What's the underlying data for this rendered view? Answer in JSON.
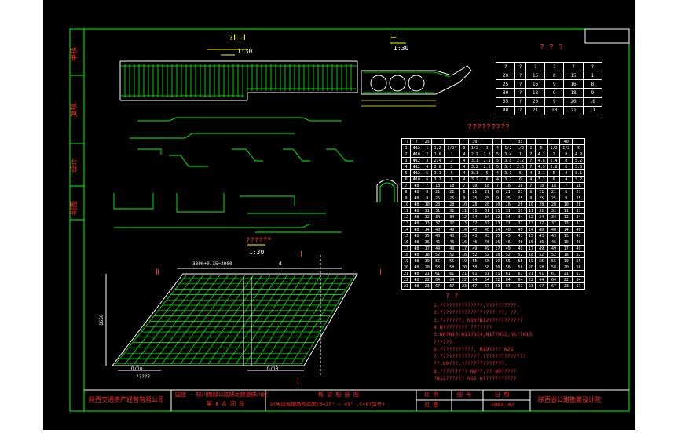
{
  "drawing": {
    "section_title_left": "?Ⅱ—Ⅱ",
    "section_scale_left": "1:30",
    "section_title_mid": "Ⅰ—Ⅰ",
    "section_scale_mid": "1:30",
    "plan_title": "??????",
    "plan_scale": "1:30",
    "small_table_title": "? ? ?",
    "big_table_title": "?????????",
    "plan_dim_top": "3300+0.35=2000",
    "plan_dim_d": "d",
    "plan_label_bl": "D/10",
    "plan_label_br": "D/10",
    "plan_note": "?????",
    "mark_I_top": "Ⅰ",
    "mark_I_bottom": "Ⅰ",
    "mark_II_left": "Ⅱ",
    "mark_I_right": "Ⅰ",
    "dim_1650": "1650"
  },
  "left_strip": {
    "labels": [
      "审核",
      "复核",
      "设计",
      "制图"
    ]
  },
  "small_table": {
    "rows": [
      [
        "?",
        "?",
        "?",
        "?",
        "?",
        "?"
      ],
      [
        "20",
        "?",
        "15",
        "8",
        "15",
        "1"
      ],
      [
        "25",
        "?",
        "16",
        "9",
        "16",
        "8"
      ],
      [
        "30",
        "?",
        "18",
        "9",
        "18",
        "9"
      ],
      [
        "35",
        "?",
        "20",
        "9",
        "20",
        "10"
      ],
      [
        "40",
        "?",
        "21",
        "10",
        "21",
        "11"
      ]
    ]
  },
  "big_table": {
    "header": [
      "??",
      "?",
      "25",
      "",
      "",
      "",
      "30",
      "",
      "",
      "",
      "35",
      "",
      "",
      "",
      "40",
      ""
    ],
    "rows": [
      [
        "1",
        "Φ12",
        "1",
        "1/2",
        "1/24",
        "3",
        "1/2",
        "1",
        "4",
        "1/2",
        "1/2",
        "1",
        "5",
        "1/2",
        "1/2",
        "5"
      ],
      [
        "2",
        "Φ10",
        "2",
        "1.6",
        "1",
        "4",
        "2.7",
        "1.8",
        "5",
        "3.4",
        "1",
        "7",
        "4.2",
        "2",
        "8",
        "4.9"
      ],
      [
        "3",
        "Φ12",
        "3",
        "2/4",
        "2",
        "4",
        "3.1",
        "2.1",
        "5",
        "3.8",
        "2.2",
        "7",
        "4.6",
        "2.4",
        "8",
        "5.2"
      ],
      [
        "4",
        "Φ12",
        "4",
        "2.8",
        "2",
        "4",
        "3.2",
        "2.8",
        "5",
        "3.9",
        "2.6",
        "7",
        "4.9",
        "2.8",
        "8",
        "5.6"
      ],
      [
        "5",
        "Φ12",
        "5",
        "3.1",
        "5",
        "4",
        "3.1",
        "5",
        "4",
        "3.1",
        "5",
        "4",
        "3.1",
        "5",
        "4",
        "3.1"
      ],
      [
        "6",
        "Φ10",
        "6",
        "3.2",
        "6",
        "4",
        "3.2",
        "6",
        "4",
        "3.2",
        "6",
        "4",
        "3.2",
        "6",
        "4",
        "3.2"
      ],
      [
        "7",
        "Φ8",
        "7",
        "18",
        "18",
        "7",
        "18",
        "18",
        "7",
        "18",
        "18",
        "7",
        "18",
        "18",
        "7",
        "18"
      ],
      [
        "8",
        "Φ8",
        "8",
        "21",
        "21",
        "8",
        "21",
        "21",
        "8",
        "21",
        "21",
        "8",
        "21",
        "21",
        "8",
        "21"
      ],
      [
        "9",
        "Φ8",
        "9",
        "25",
        "25",
        "9",
        "25",
        "25",
        "9",
        "25",
        "25",
        "9",
        "25",
        "25",
        "9",
        "25"
      ],
      [
        "10",
        "Φ8",
        "10",
        "28",
        "28",
        "10",
        "28",
        "28",
        "10",
        "28",
        "28",
        "10",
        "28",
        "28",
        "10",
        "28"
      ],
      [
        "11",
        "Φ8",
        "11",
        "31",
        "31",
        "11",
        "31",
        "31",
        "11",
        "31",
        "31",
        "11",
        "31",
        "31",
        "11",
        "31"
      ],
      [
        "12",
        "Φ8",
        "12",
        "34",
        "34",
        "12",
        "34",
        "34",
        "12",
        "34",
        "34",
        "12",
        "34",
        "34",
        "12",
        "34"
      ],
      [
        "13",
        "Φ8",
        "13",
        "37",
        "37",
        "13",
        "37",
        "37",
        "13",
        "37",
        "37",
        "13",
        "37",
        "37",
        "13",
        "37"
      ],
      [
        "14",
        "Φ8",
        "14",
        "40",
        "40",
        "14",
        "40",
        "40",
        "14",
        "40",
        "40",
        "14",
        "40",
        "40",
        "14",
        "40"
      ],
      [
        "15",
        "Φ8",
        "15",
        "43",
        "43",
        "15",
        "43",
        "43",
        "15",
        "43",
        "43",
        "15",
        "43",
        "43",
        "15",
        "43"
      ],
      [
        "16",
        "Φ8",
        "16",
        "46",
        "46",
        "16",
        "46",
        "46",
        "16",
        "46",
        "46",
        "16",
        "46",
        "46",
        "16",
        "46"
      ],
      [
        "17",
        "Φ8",
        "17",
        "49",
        "49",
        "17",
        "49",
        "49",
        "17",
        "49",
        "49",
        "17",
        "49",
        "49",
        "17",
        "49"
      ],
      [
        "18",
        "Φ8",
        "18",
        "52",
        "52",
        "18",
        "52",
        "52",
        "18",
        "52",
        "52",
        "18",
        "52",
        "52",
        "18",
        "52"
      ],
      [
        "19",
        "Φ8",
        "19",
        "55",
        "55",
        "19",
        "55",
        "55",
        "19",
        "55",
        "55",
        "19",
        "55",
        "55",
        "19",
        "55"
      ],
      [
        "20",
        "Φ8",
        "20",
        "58",
        "58",
        "20",
        "58",
        "58",
        "20",
        "58",
        "58",
        "20",
        "58",
        "58",
        "20",
        "58"
      ],
      [
        "21",
        "Φ8",
        "21",
        "61",
        "61",
        "21",
        "61",
        "61",
        "21",
        "61",
        "61",
        "21",
        "61",
        "61",
        "21",
        "61"
      ],
      [
        "22",
        "Φ8",
        "22",
        "64",
        "64",
        "22",
        "64",
        "64",
        "22",
        "64",
        "64",
        "22",
        "64",
        "64",
        "22",
        "64"
      ],
      [
        "23",
        "Φ8",
        "23",
        "67",
        "67",
        "23",
        "67",
        "67",
        "23",
        "67",
        "67",
        "23",
        "67",
        "67",
        "23",
        "67"
      ]
    ]
  },
  "notes": {
    "title": "? ?",
    "lines": [
      "1.??????????????,??????????.",
      "2.????????????.????? ??, ??.",
      "3.???????, N10?N12???????????",
      "4.N????????  ???????",
      "5.N8?N10,N11?N14,N17?N12,N1??N15",
      "   ??????.",
      "6.???????????,    N19????      N21",
      "7.?????????????,??????????????",
      "   ??.60???,??????????????.",
      "8.?????????  N9??,??   N9?????",
      "   ?N12??????   N12 N???????????"
    ]
  },
  "title_block": {
    "company": "陕西交通资产经营有限公司",
    "project_line1": "国道 - 陕川南部公路陕北隧道陕川段",
    "project_line2": "第 Ⅱ 合 同 段",
    "drawing_name": "板 梁 配 筋 图",
    "drawing_desc": "10米边板钢筋构造图(θ=25° — 45° ,C=8?型号)",
    "col1_label": "比 例",
    "col1_value": "见 图",
    "col2_label": "图 号",
    "col2_value": "",
    "col3_label": "日 期",
    "col3_value": "2004.02",
    "designer": "陕西省公路勘察设计院"
  },
  "colors": {
    "frame": "#00ff00",
    "text_yellow": "#ffff00",
    "text_red": "#ff3030",
    "lines_white": "#ffffff",
    "rebar_green": "#00ff00",
    "background": "#000000"
  }
}
